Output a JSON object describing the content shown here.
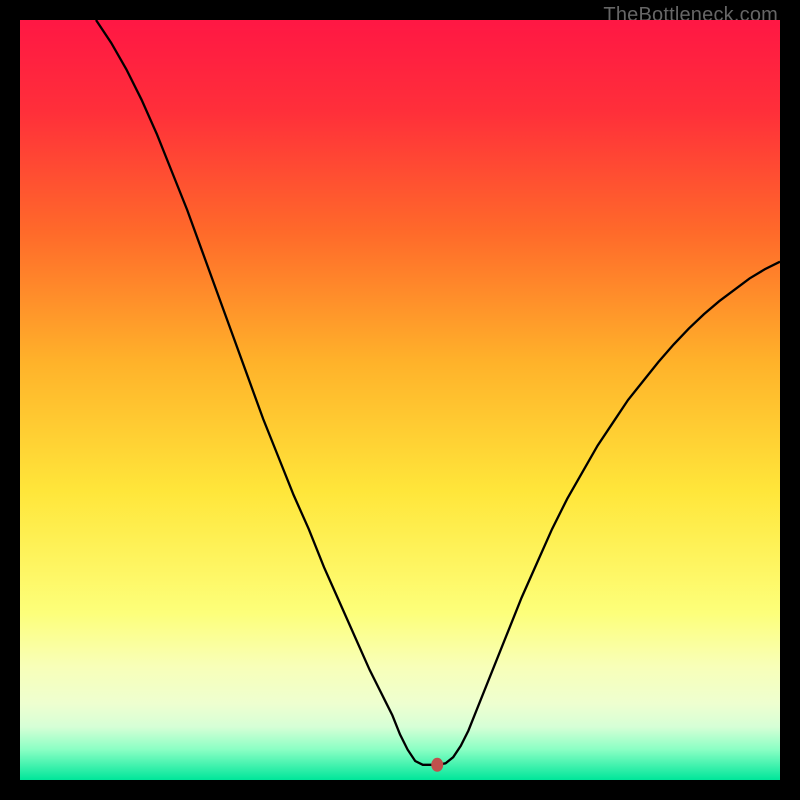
{
  "watermark": "TheBottleneck.com",
  "chart_data": {
    "type": "line",
    "title": "",
    "xlabel": "",
    "ylabel": "",
    "xlim": [
      0,
      100
    ],
    "ylim": [
      0,
      100
    ],
    "background_gradient": {
      "stops": [
        {
          "offset": 0.0,
          "color": "#ff1744"
        },
        {
          "offset": 0.12,
          "color": "#ff2f3a"
        },
        {
          "offset": 0.28,
          "color": "#ff6a2a"
        },
        {
          "offset": 0.45,
          "color": "#ffb22a"
        },
        {
          "offset": 0.62,
          "color": "#ffe63a"
        },
        {
          "offset": 0.78,
          "color": "#fdff7a"
        },
        {
          "offset": 0.85,
          "color": "#f8ffb8"
        },
        {
          "offset": 0.9,
          "color": "#eeffd0"
        },
        {
          "offset": 0.93,
          "color": "#d6ffd6"
        },
        {
          "offset": 0.96,
          "color": "#8affc4"
        },
        {
          "offset": 1.0,
          "color": "#00e69a"
        }
      ]
    },
    "marker": {
      "x": 54.9,
      "y": 2.0,
      "color": "#c0504d"
    },
    "series": [
      {
        "name": "curve",
        "color": "#000000",
        "width": 2.3,
        "points": [
          {
            "x": 10.0,
            "y": 100.0
          },
          {
            "x": 12.0,
            "y": 97.0
          },
          {
            "x": 14.0,
            "y": 93.5
          },
          {
            "x": 16.0,
            "y": 89.5
          },
          {
            "x": 18.0,
            "y": 85.0
          },
          {
            "x": 20.0,
            "y": 80.0
          },
          {
            "x": 22.0,
            "y": 75.0
          },
          {
            "x": 24.0,
            "y": 69.5
          },
          {
            "x": 26.0,
            "y": 64.0
          },
          {
            "x": 28.0,
            "y": 58.5
          },
          {
            "x": 30.0,
            "y": 53.0
          },
          {
            "x": 32.0,
            "y": 47.5
          },
          {
            "x": 34.0,
            "y": 42.5
          },
          {
            "x": 36.0,
            "y": 37.5
          },
          {
            "x": 38.0,
            "y": 33.0
          },
          {
            "x": 40.0,
            "y": 28.0
          },
          {
            "x": 42.0,
            "y": 23.5
          },
          {
            "x": 44.0,
            "y": 19.0
          },
          {
            "x": 46.0,
            "y": 14.5
          },
          {
            "x": 48.0,
            "y": 10.5
          },
          {
            "x": 49.0,
            "y": 8.5
          },
          {
            "x": 50.0,
            "y": 6.0
          },
          {
            "x": 51.0,
            "y": 4.0
          },
          {
            "x": 52.0,
            "y": 2.5
          },
          {
            "x": 53.0,
            "y": 2.0
          },
          {
            "x": 54.0,
            "y": 2.0
          },
          {
            "x": 55.0,
            "y": 2.0
          },
          {
            "x": 56.0,
            "y": 2.2
          },
          {
            "x": 57.0,
            "y": 3.0
          },
          {
            "x": 58.0,
            "y": 4.5
          },
          {
            "x": 59.0,
            "y": 6.5
          },
          {
            "x": 60.0,
            "y": 9.0
          },
          {
            "x": 62.0,
            "y": 14.0
          },
          {
            "x": 64.0,
            "y": 19.0
          },
          {
            "x": 66.0,
            "y": 24.0
          },
          {
            "x": 68.0,
            "y": 28.5
          },
          {
            "x": 70.0,
            "y": 33.0
          },
          {
            "x": 72.0,
            "y": 37.0
          },
          {
            "x": 74.0,
            "y": 40.5
          },
          {
            "x": 76.0,
            "y": 44.0
          },
          {
            "x": 78.0,
            "y": 47.0
          },
          {
            "x": 80.0,
            "y": 50.0
          },
          {
            "x": 82.0,
            "y": 52.5
          },
          {
            "x": 84.0,
            "y": 55.0
          },
          {
            "x": 86.0,
            "y": 57.3
          },
          {
            "x": 88.0,
            "y": 59.4
          },
          {
            "x": 90.0,
            "y": 61.3
          },
          {
            "x": 92.0,
            "y": 63.0
          },
          {
            "x": 94.0,
            "y": 64.5
          },
          {
            "x": 96.0,
            "y": 66.0
          },
          {
            "x": 98.0,
            "y": 67.2
          },
          {
            "x": 100.0,
            "y": 68.2
          }
        ]
      }
    ]
  }
}
